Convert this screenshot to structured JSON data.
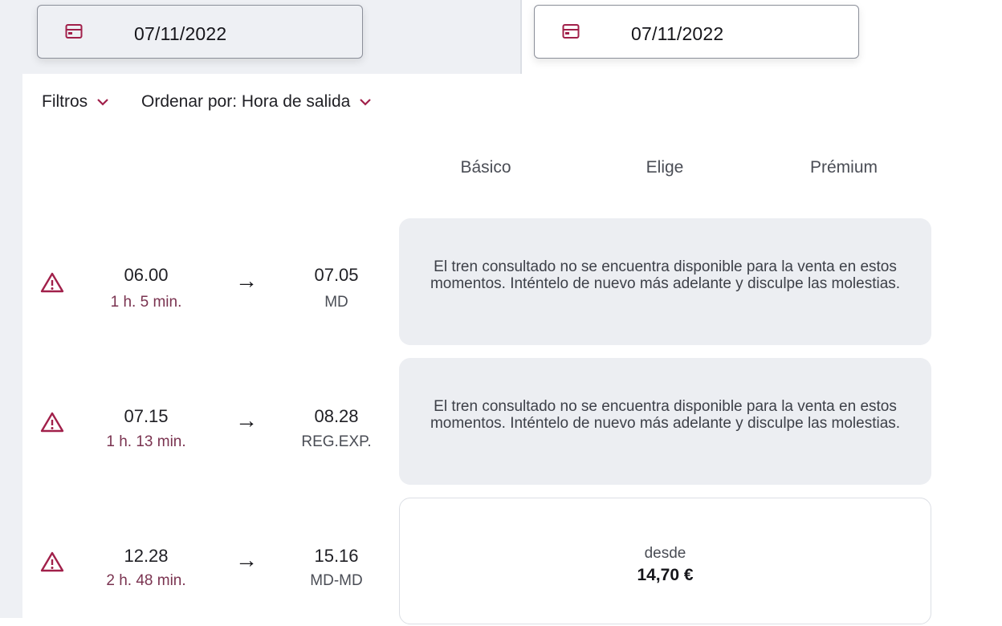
{
  "dates": {
    "outbound": "07/11/2022",
    "return": "07/11/2022"
  },
  "toolbar": {
    "filters_label": "Filtros",
    "sort_label": "Ordenar por: Hora de salida"
  },
  "fare_columns": [
    "Básico",
    "Elige",
    "Prémium"
  ],
  "icons": {
    "calendar": "calendar-icon",
    "chevron": "chevron-down-icon",
    "warning": "warning-icon",
    "arrow": "arrow-right-icon"
  },
  "colors": {
    "accent": "#a1204a",
    "duration_text": "#7a3350",
    "unavailable_bg": "#eceef2"
  },
  "trips": [
    {
      "departure": "06.00",
      "duration": "1 h. 5 min.",
      "arrow": "→",
      "arrival": "07.05",
      "train": "MD",
      "message": "El tren consultado no se encuentra disponible para la venta en estos momentos. Inténtelo de nuevo más adelante y disculpe las molestias."
    },
    {
      "departure": "07.15",
      "duration": "1 h. 13 min.",
      "arrow": "→",
      "arrival": "08.28",
      "train": "REG.EXP.",
      "message": "El tren consultado no se encuentra disponible para la venta en estos momentos. Inténtelo de nuevo más adelante y disculpe las molestias."
    },
    {
      "departure": "12.28",
      "duration": "2 h. 48 min.",
      "arrow": "→",
      "arrival": "15.16",
      "train": "MD-MD",
      "from_label": "desde",
      "price": "14,70 €"
    }
  ]
}
